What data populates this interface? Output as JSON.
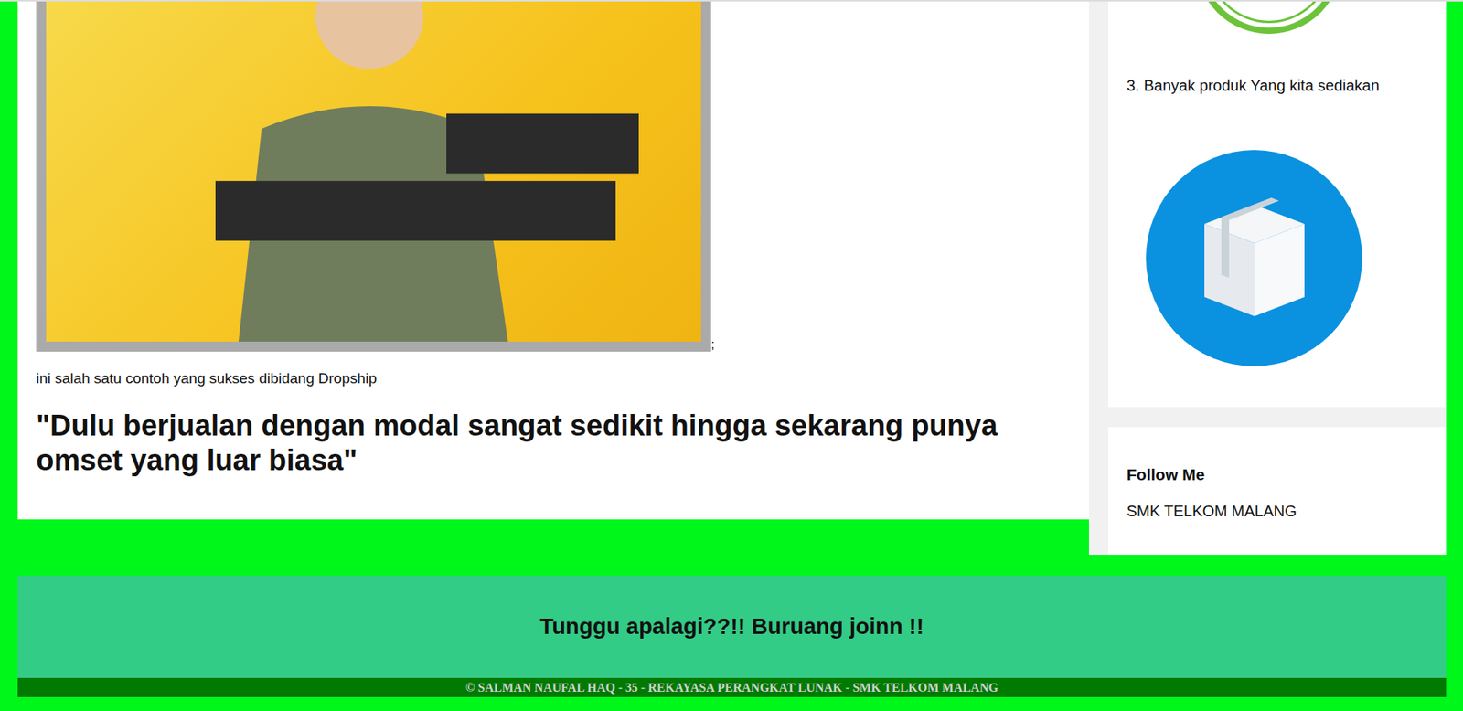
{
  "main": {
    "separator": ";",
    "caption": "ini salah satu contoh yang sukses dibidang Dropship",
    "quote": "\"Dulu berjualan dengan modal sangat sedikit hingga sekarang punya omset yang luar biasa\""
  },
  "sidebar": {
    "features": [
      {
        "text": "3. Banyak produk Yang kita sediakan"
      }
    ],
    "follow": {
      "title": "Follow Me",
      "text": "SMK TELKOM MALANG"
    }
  },
  "cta": {
    "text": "Tunggu apalagi??!! Buruang joinn !!"
  },
  "footer": {
    "text": "© SALMAN NAUFAL HAQ - 35 - REKAYASA PERANGKAT LUNAK - SMK TELKOM MALANG"
  }
}
